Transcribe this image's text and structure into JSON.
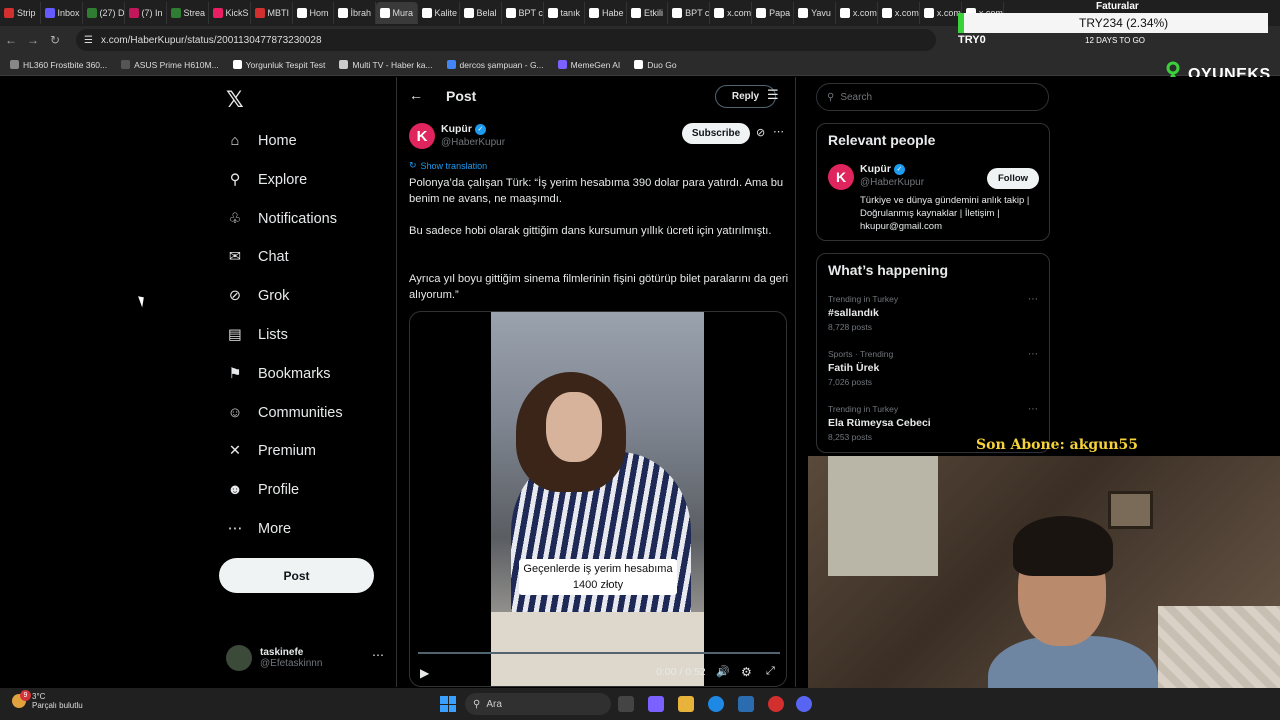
{
  "browser": {
    "tabs": [
      "Strip",
      "Inbox",
      "(27) D",
      "(7) In",
      "Strea",
      "KickS",
      "MBTI",
      "Hom",
      "İbrah",
      "Mura",
      "Kalite",
      "Belal",
      "BPT c",
      "tanık",
      "Habe",
      "Etkili",
      "BPT c",
      "x.com",
      "Papa",
      "Yavu",
      "x.com",
      "x.com",
      "x.com",
      "x.com"
    ],
    "url": "x.com/HaberKupur/status/2001130477873230028",
    "bookmarks": [
      "HL360 Frostbite 360...",
      "ASUS Prime H610M...",
      "Yorgunluk Tespit Test",
      "Multi TV - Haber ka...",
      "dercos şampuan - G...",
      "MemeGen AI",
      "Duo Go"
    ]
  },
  "overlay": {
    "ticker_label": "Faturalar",
    "ticker_value": "TRY234 (2.34%)",
    "try_label": "TRY0",
    "days_label": "12 DAYS TO GO",
    "brand": "OYUNEKS",
    "subscriber": "Son Abone: akgun55"
  },
  "nav": {
    "items": [
      {
        "label": "Home",
        "icon": "home-icon"
      },
      {
        "label": "Explore",
        "icon": "search-icon"
      },
      {
        "label": "Notifications",
        "icon": "bell-icon"
      },
      {
        "label": "Chat",
        "icon": "mail-icon"
      },
      {
        "label": "Grok",
        "icon": "grok-icon"
      },
      {
        "label": "Lists",
        "icon": "list-icon"
      },
      {
        "label": "Bookmarks",
        "icon": "bookmark-icon"
      },
      {
        "label": "Communities",
        "icon": "people-icon"
      },
      {
        "label": "Premium",
        "icon": "x-icon"
      },
      {
        "label": "Profile",
        "icon": "person-icon"
      },
      {
        "label": "More",
        "icon": "more-circle-icon"
      }
    ],
    "post_button": "Post",
    "me": {
      "name": "taskinefe",
      "handle": "@Efetaskinnn"
    }
  },
  "post": {
    "header_title": "Post",
    "reply_button": "Reply",
    "author": {
      "name": "Kupür",
      "handle": "@HaberKupur",
      "avatar_letter": "K"
    },
    "subscribe_button": "Subscribe",
    "show_translation": "Show translation",
    "paragraphs": [
      "Polonya’da çalışan Türk: “İş yerim hesabıma 390 dolar para yatırdı. Ama bu benim ne avans, ne maaşımdı.",
      "Bu sadece hobi olarak gittiğim dans kursumun yıllık ücreti için yatırılmıştı.",
      "Ayrıca yıl boyu gittiğim sinema filmlerinin fişini götürüp bilet paralarını da geri alıyorum.”"
    ],
    "video": {
      "caption_line1": "Geçenlerde iş yerim hesabıma",
      "caption_line2": "1400 złoty",
      "time": "0:00 / 0:52"
    }
  },
  "sidebar": {
    "search_placeholder": "Search",
    "relevant_title": "Relevant people",
    "relevant": {
      "name": "Kupür",
      "handle": "@HaberKupur",
      "avatar_letter": "K",
      "follow_button": "Follow",
      "bio": "Türkiye ve dünya gündemini anlık takip | Doğrulanmış kaynaklar | İletişim | hkupur@gmail.com"
    },
    "trends_title": "What’s happening",
    "trends": [
      {
        "meta": "Trending in Turkey",
        "topic": "#sallandık",
        "posts": "8,728 posts"
      },
      {
        "meta": "Sports · Trending",
        "topic": "Fatih Ürek",
        "posts": "7,026 posts"
      },
      {
        "meta": "Trending in Turkey",
        "topic": "Ela Rümeysa Cebeci",
        "posts": "8,253 posts"
      }
    ]
  },
  "taskbar": {
    "temp": "3°C",
    "weather": "Parçalı bulutlu",
    "weather_badge": "9",
    "search_placeholder": "Ara"
  }
}
